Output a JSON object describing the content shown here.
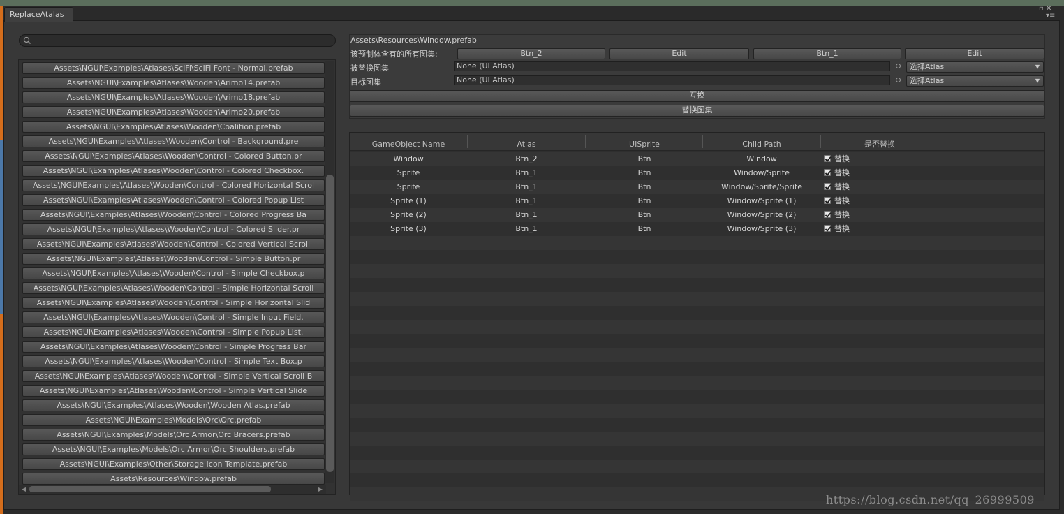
{
  "window": {
    "tab_title": "ReplaceAtalas",
    "menu_glyph": "▫ ✕",
    "list_glyph": "▾≡"
  },
  "search": {
    "placeholder": ""
  },
  "prefab_list": [
    "Assets\\NGUI\\Examples\\Atlases\\SciFi\\SciFi Font - Normal.prefab",
    "Assets\\NGUI\\Examples\\Atlases\\Wooden\\Arimo14.prefab",
    "Assets\\NGUI\\Examples\\Atlases\\Wooden\\Arimo18.prefab",
    "Assets\\NGUI\\Examples\\Atlases\\Wooden\\Arimo20.prefab",
    "Assets\\NGUI\\Examples\\Atlases\\Wooden\\Coalition.prefab",
    "Assets\\NGUI\\Examples\\Atlases\\Wooden\\Control - Background.pre",
    "Assets\\NGUI\\Examples\\Atlases\\Wooden\\Control - Colored Button.pr",
    "Assets\\NGUI\\Examples\\Atlases\\Wooden\\Control - Colored Checkbox.",
    "Assets\\NGUI\\Examples\\Atlases\\Wooden\\Control - Colored Horizontal Scrol",
    "Assets\\NGUI\\Examples\\Atlases\\Wooden\\Control - Colored Popup List",
    "Assets\\NGUI\\Examples\\Atlases\\Wooden\\Control - Colored Progress Ba",
    "Assets\\NGUI\\Examples\\Atlases\\Wooden\\Control - Colored Slider.pr",
    "Assets\\NGUI\\Examples\\Atlases\\Wooden\\Control - Colored Vertical Scroll",
    "Assets\\NGUI\\Examples\\Atlases\\Wooden\\Control - Simple Button.pr",
    "Assets\\NGUI\\Examples\\Atlases\\Wooden\\Control - Simple Checkbox.p",
    "Assets\\NGUI\\Examples\\Atlases\\Wooden\\Control - Simple Horizontal Scroll",
    "Assets\\NGUI\\Examples\\Atlases\\Wooden\\Control - Simple Horizontal Slid",
    "Assets\\NGUI\\Examples\\Atlases\\Wooden\\Control - Simple Input Field.",
    "Assets\\NGUI\\Examples\\Atlases\\Wooden\\Control - Simple Popup List.",
    "Assets\\NGUI\\Examples\\Atlases\\Wooden\\Control - Simple Progress Bar",
    "Assets\\NGUI\\Examples\\Atlases\\Wooden\\Control - Simple Text Box.p",
    "Assets\\NGUI\\Examples\\Atlases\\Wooden\\Control - Simple Vertical Scroll B",
    "Assets\\NGUI\\Examples\\Atlases\\Wooden\\Control - Simple Vertical Slide",
    "Assets\\NGUI\\Examples\\Atlases\\Wooden\\Wooden Atlas.prefab",
    "Assets\\NGUI\\Examples\\Models\\Orc\\Orc.prefab",
    "Assets\\NGUI\\Examples\\Models\\Orc Armor\\Orc Bracers.prefab",
    "Assets\\NGUI\\Examples\\Models\\Orc Armor\\Orc Shoulders.prefab",
    "Assets\\NGUI\\Examples\\Other\\Storage Icon Template.prefab",
    "Assets\\Resources\\Window.prefab"
  ],
  "detail": {
    "selected_path": "Assets\\Resources\\Window.prefab",
    "atlases_label": "该预制体含有的所有图集:",
    "atlas_buttons": [
      "Btn_2",
      "Edit",
      "Btn_1",
      "Edit"
    ],
    "replaced_label": "被替换图集",
    "replaced_value": "None (UI Atlas)",
    "replaced_dropdown": "选择Atlas",
    "target_label": "目标图集",
    "target_value": "None (UI Atlas)",
    "target_dropdown": "选择Atlas",
    "swap_button": "互换",
    "replace_button": "替换图集"
  },
  "table": {
    "columns": [
      "GameObject Name",
      "Atlas",
      "UISprite",
      "Child Path",
      "是否替换"
    ],
    "checkbox_label": "替换",
    "rows": [
      [
        "Window",
        "Btn_2",
        "Btn",
        "Window"
      ],
      [
        "Sprite",
        "Btn_1",
        "Btn",
        "Window/Sprite"
      ],
      [
        "Sprite",
        "Btn_1",
        "Btn",
        "Window/Sprite/Sprite"
      ],
      [
        "Sprite (1)",
        "Btn_1",
        "Btn",
        "Window/Sprite (1)"
      ],
      [
        "Sprite (2)",
        "Btn_1",
        "Btn",
        "Window/Sprite (2)"
      ],
      [
        "Sprite (3)",
        "Btn_1",
        "Btn",
        "Window/Sprite (3)"
      ]
    ]
  },
  "watermark": "https://blog.csdn.net/qq_26999509",
  "colors": {
    "panel": "#383838",
    "window_top": "#5b6e5c",
    "accent_left": "#d46d1c"
  }
}
